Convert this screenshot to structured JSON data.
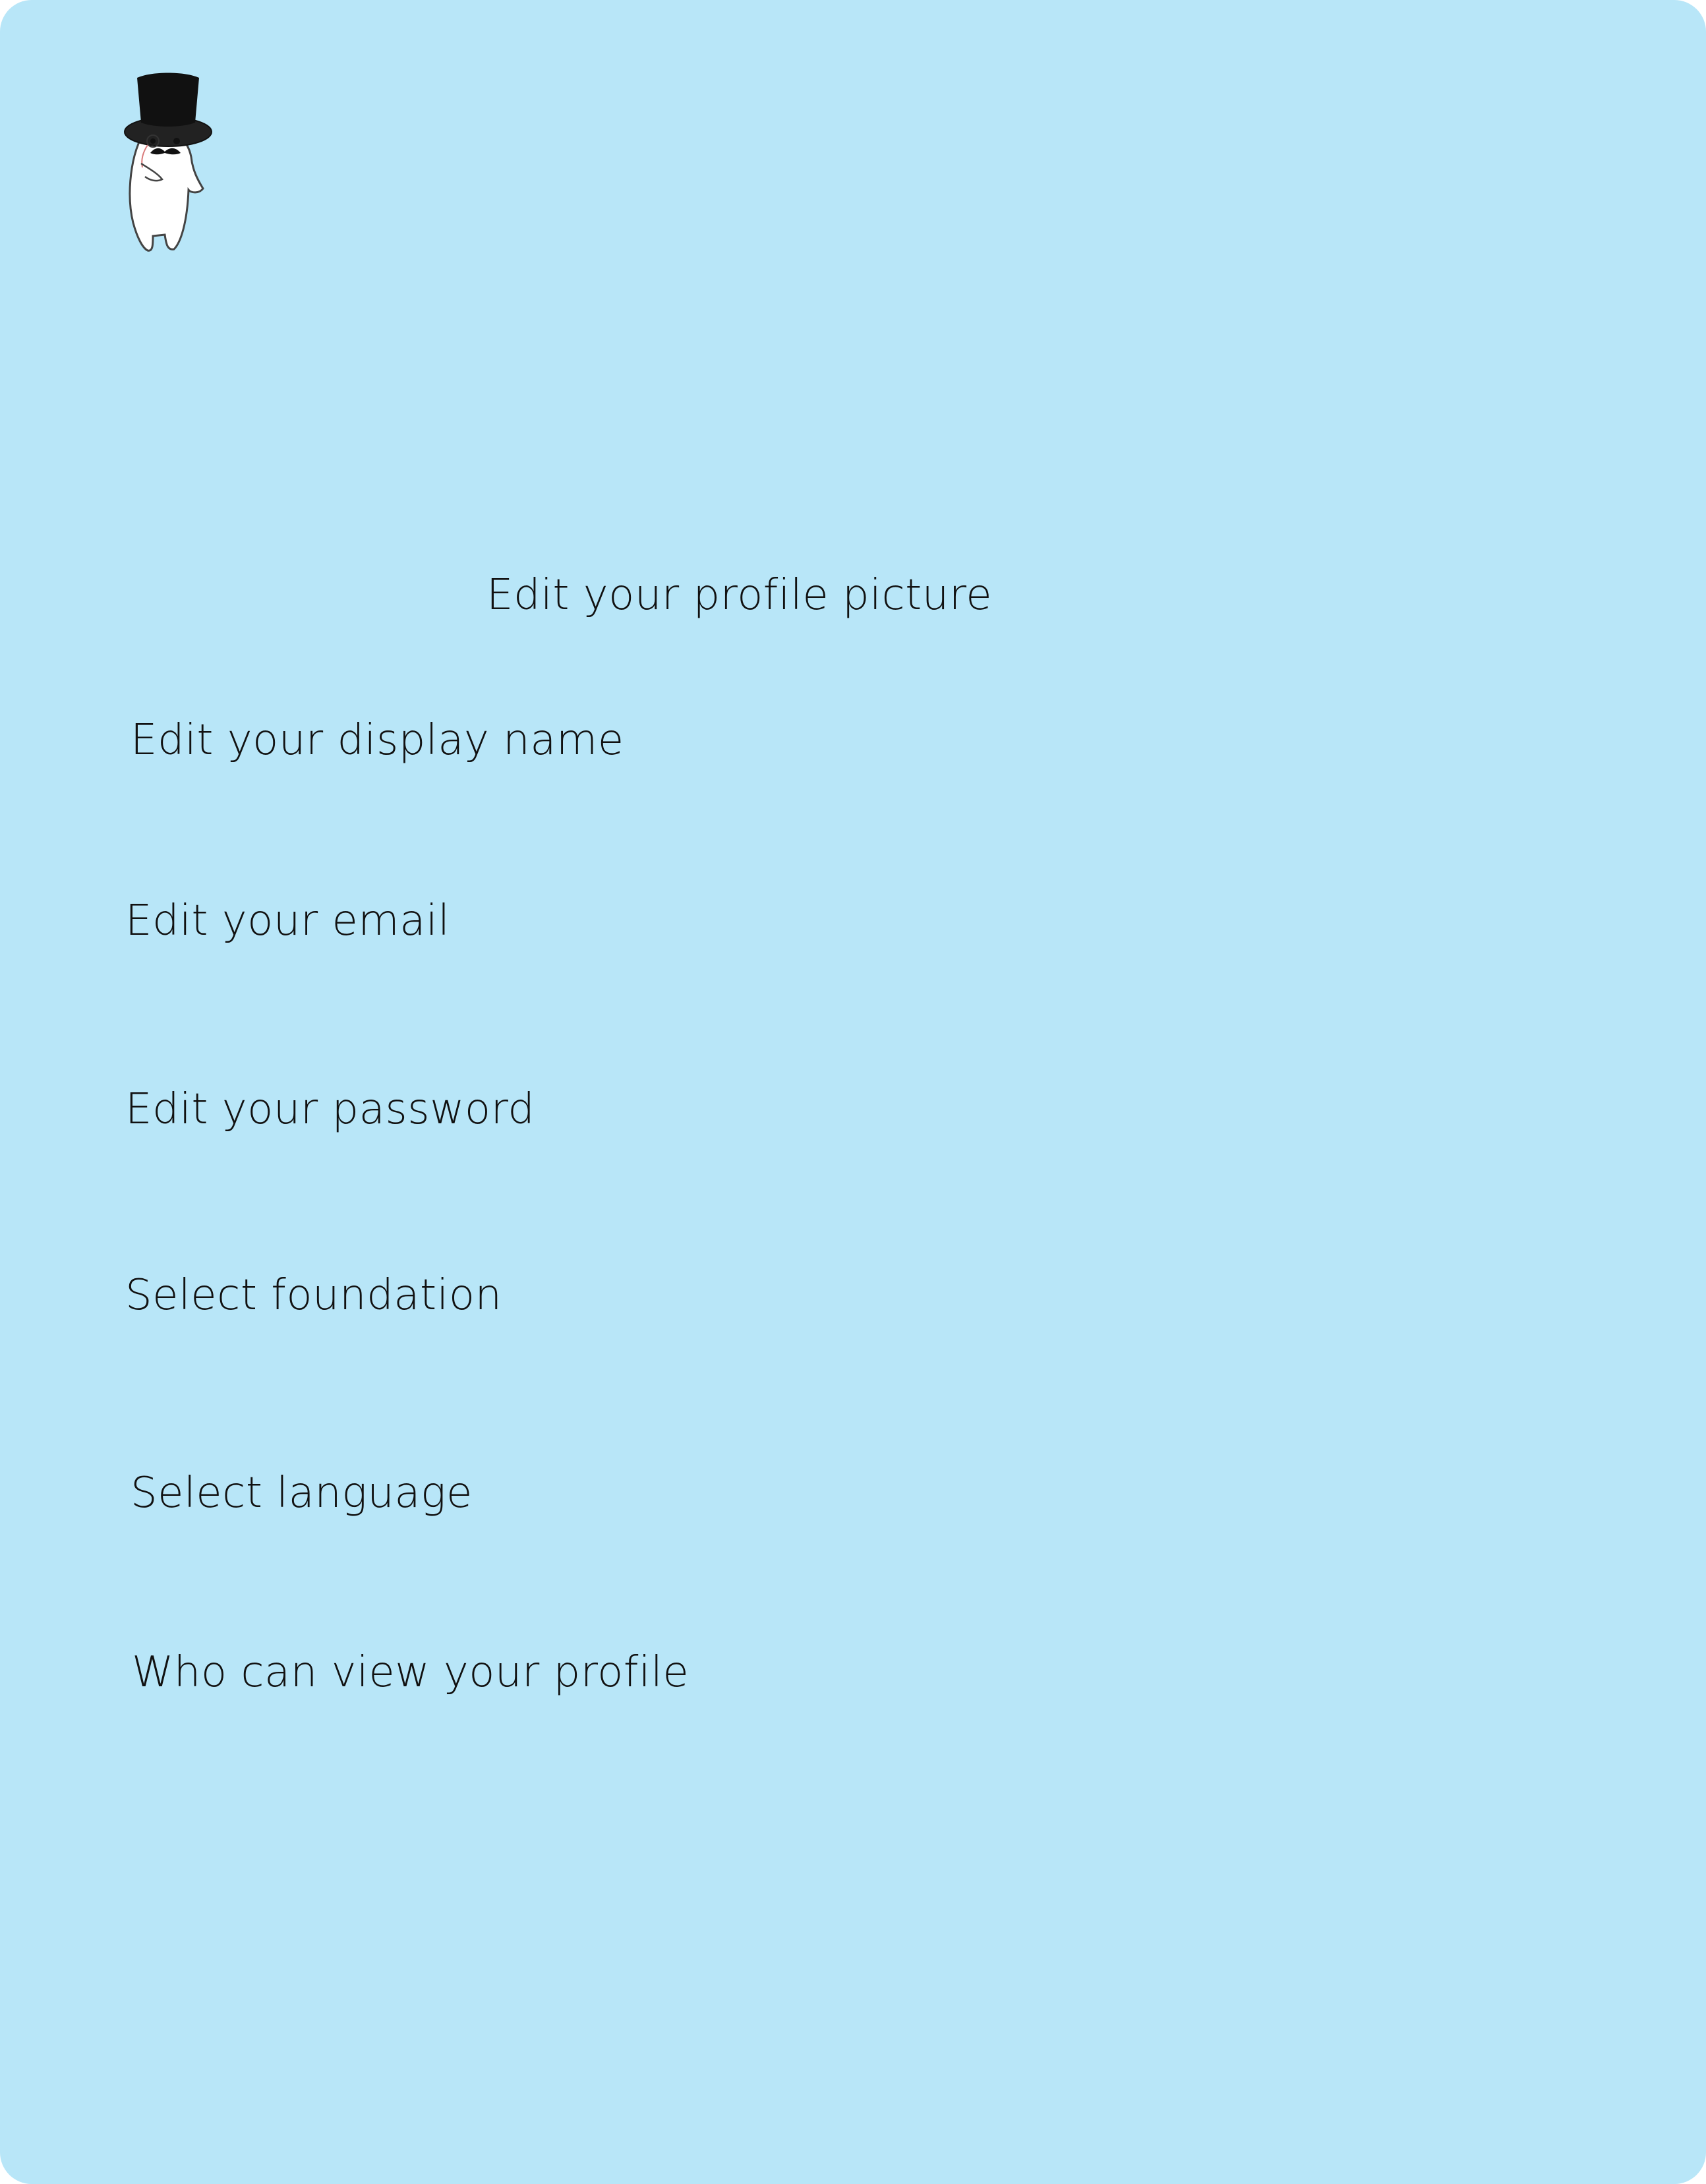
{
  "mascot": {
    "icon": "top-hat-ghost-mascot-icon"
  },
  "settings": {
    "profile_picture": "Edit your profile picture",
    "display_name": "Edit your display name",
    "email": "Edit your email",
    "password": "Edit your password",
    "foundation": "Select foundation",
    "language": "Select language",
    "profile_visibility": "Who can view your profile"
  },
  "colors": {
    "background": "#b8e6f8",
    "text": "#111111"
  }
}
